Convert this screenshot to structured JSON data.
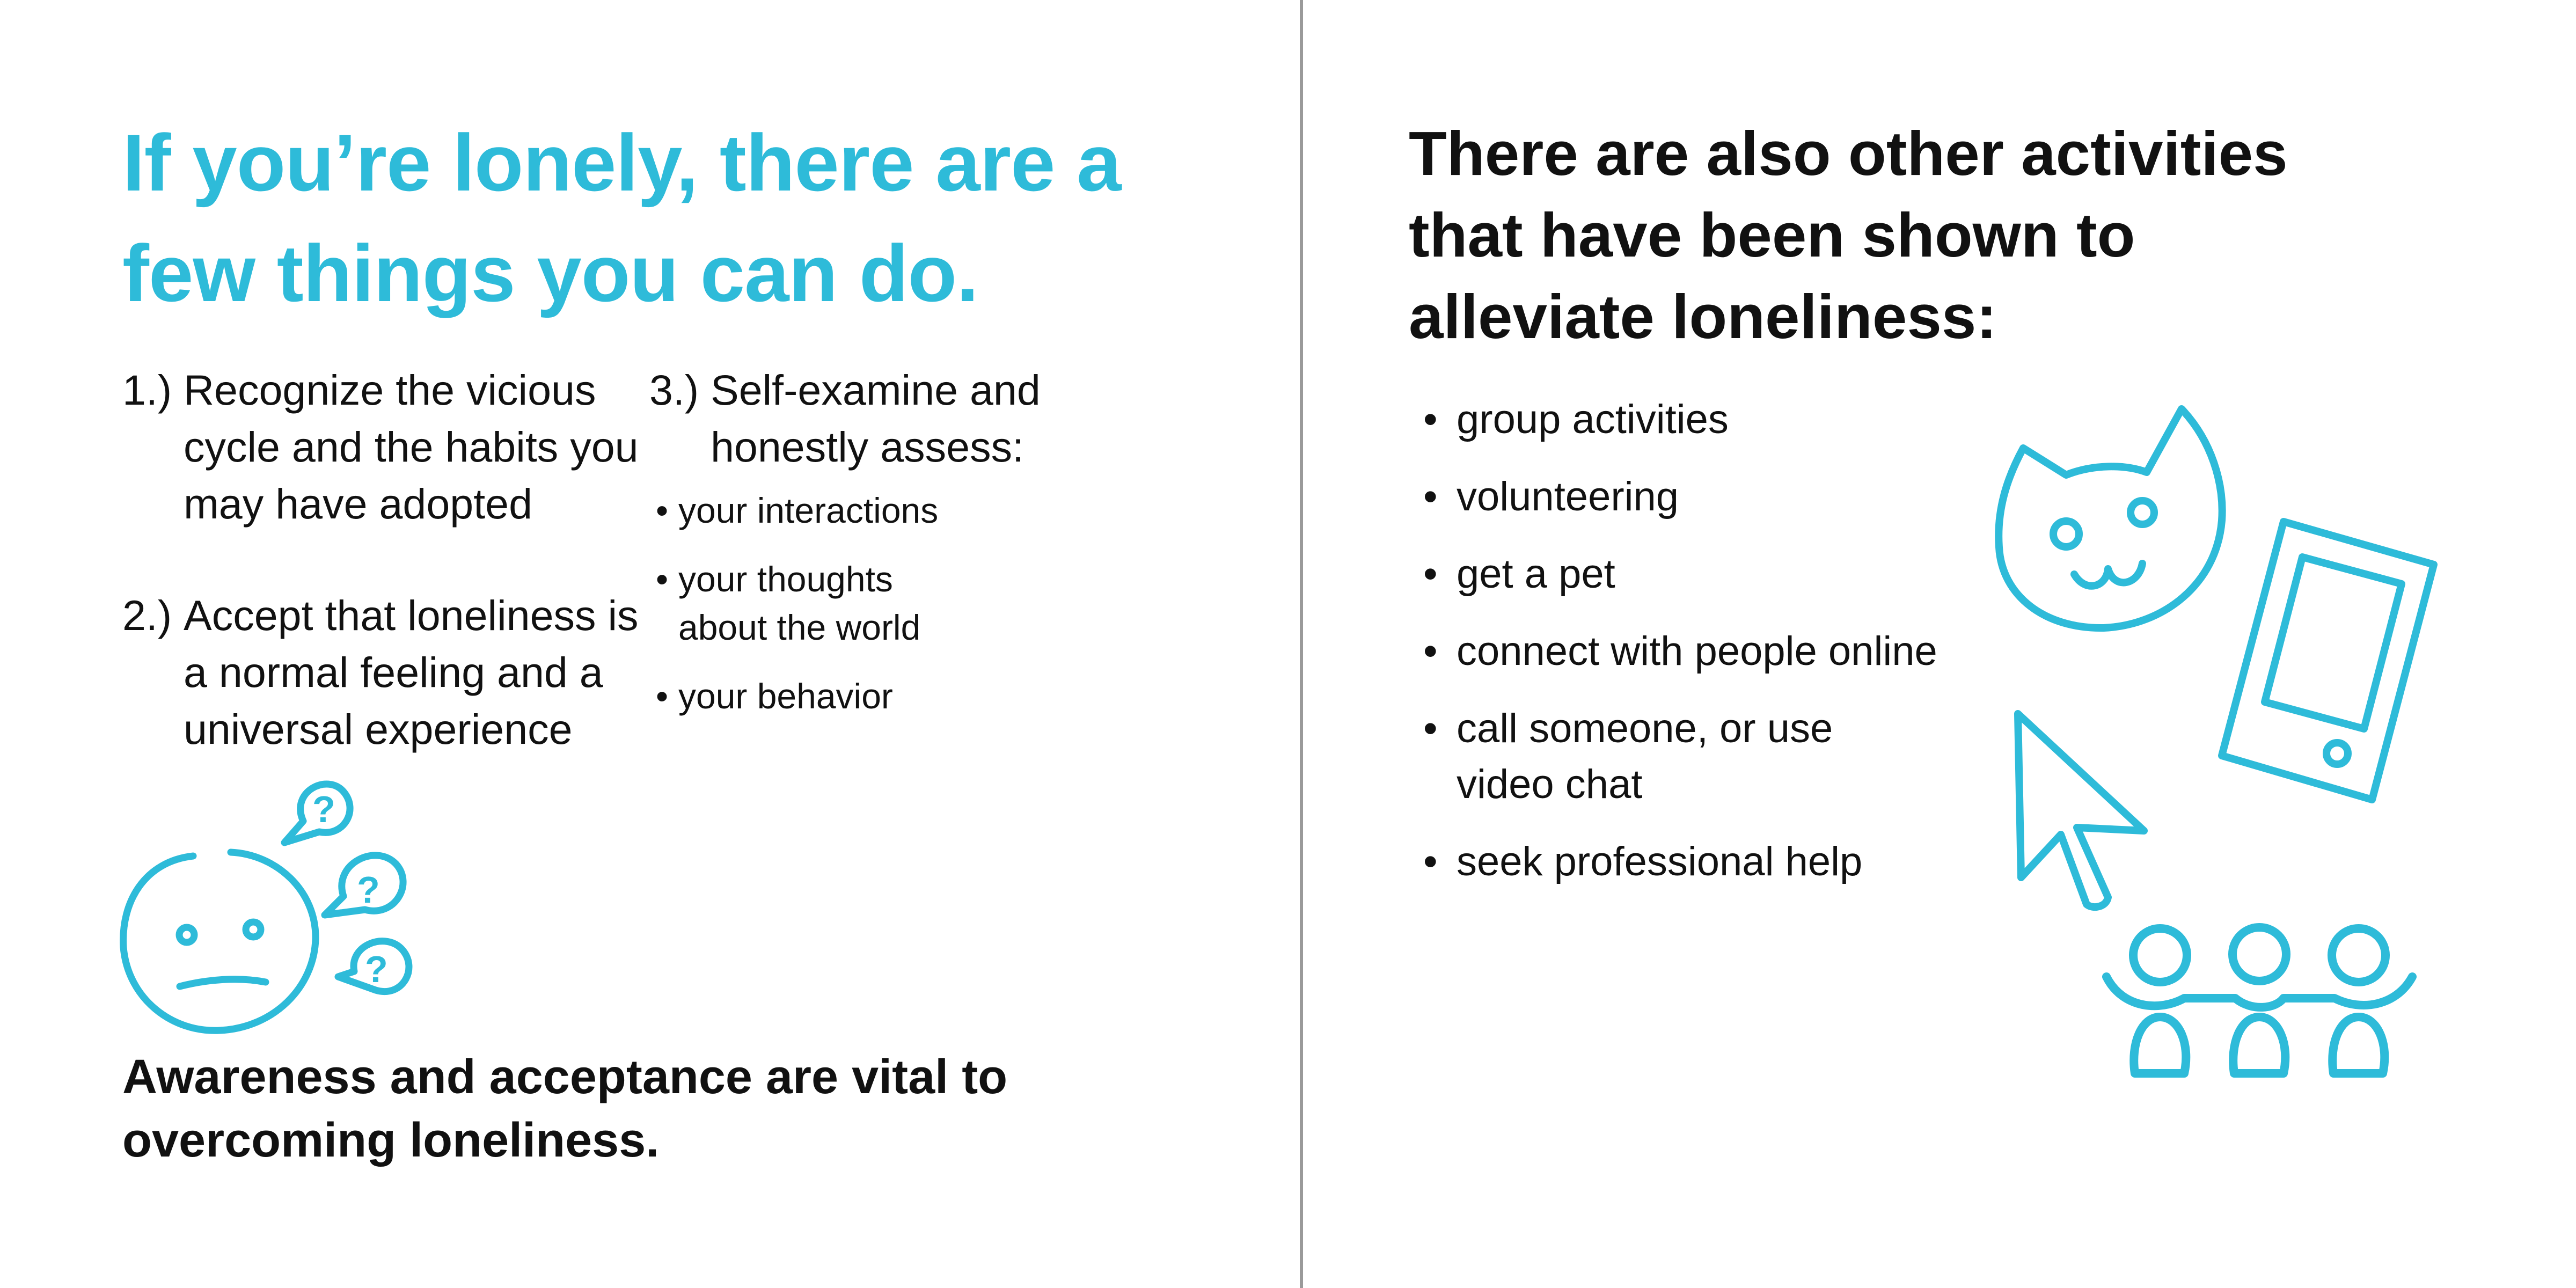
{
  "left_page": {
    "headline": "If you’re lonely, there are a few things you can do.",
    "steps": [
      {
        "number": "1.)",
        "text": "Recognize the vicious cycle and the habits you may have adopted"
      },
      {
        "number": "2.)",
        "text": "Accept that loneliness is a normal feeling and a universal experience"
      },
      {
        "number": "3.)",
        "text": "Self-examine and honestly assess:"
      }
    ],
    "assess_items": [
      "your interactions",
      "your thoughts about the world",
      "your behavior"
    ],
    "closing": "Awareness and acceptance are vital to overcoming loneliness.",
    "illustration_icon": "confused-face-with-question-bubbles-icon"
  },
  "right_page": {
    "heading": "There are also other activities that have been shown to alleviate loneliness:",
    "bullet": "•",
    "activities": [
      "group activities",
      "volunteering",
      "get a pet",
      "connect with people online",
      "call someone, or use video chat",
      "seek professional help"
    ],
    "illustration_icons": [
      "cat-face-icon",
      "smartphone-icon",
      "cursor-arrow-icon",
      "three-people-icon"
    ]
  },
  "colors": {
    "accent": "#2ebbd9",
    "text": "#111111",
    "background": "#ffffff",
    "spine": "#9a9a9a"
  }
}
